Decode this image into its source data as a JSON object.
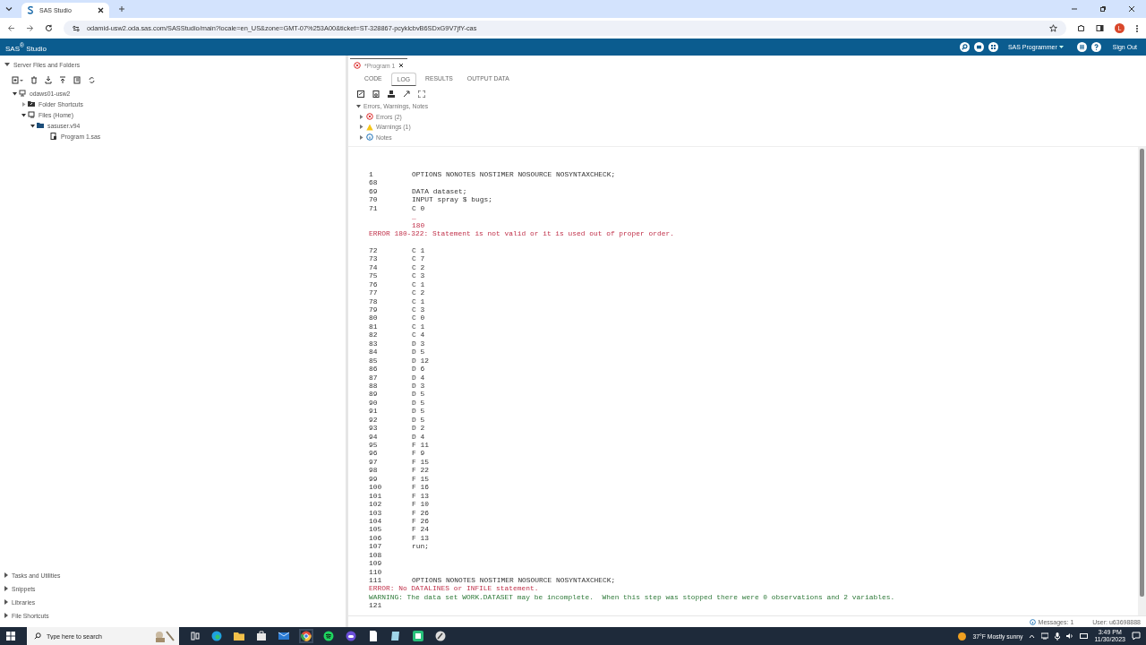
{
  "browser": {
    "tab_title": "SAS Studio",
    "url": "odamid-usw2.oda.sas.com/SASStudio/main?locale=en_US&zone=GMT-07%253A00&ticket=ST-328867-pcyklcbvB6SDxG9V7jfY-cas",
    "profile_initial": "L"
  },
  "app_header": {
    "title": "SAS$^{®}$ Studio",
    "role_menu": "SAS Programmer",
    "sign_out": "Sign Out"
  },
  "sidebar": {
    "section": "Server Files and Folders",
    "expanded": true,
    "tree": [
      {
        "label": "odaws01-usw2",
        "kind": "server",
        "expanded": true,
        "children": [
          {
            "label": "Folder Shortcuts",
            "kind": "shortcuts",
            "expanded": false
          },
          {
            "label": "Files (Home)",
            "kind": "home",
            "expanded": true,
            "children": [
              {
                "label": "sasuser.v94",
                "kind": "folder",
                "expanded": true,
                "children": [
                  {
                    "label": "Program 1.sas",
                    "kind": "program"
                  }
                ]
              }
            ]
          }
        ]
      }
    ],
    "sections": [
      {
        "label": "Tasks and Utilities"
      },
      {
        "label": "Snippets"
      },
      {
        "label": "Libraries"
      },
      {
        "label": "File Shortcuts"
      }
    ]
  },
  "editor": {
    "tab": {
      "title": "*Program 1"
    },
    "subtabs": [
      {
        "label": "CODE",
        "selected": false
      },
      {
        "label": "LOG",
        "selected": true
      },
      {
        "label": "RESULTS",
        "selected": false
      },
      {
        "label": "OUTPUT DATA",
        "selected": false
      }
    ],
    "messages": {
      "title": "Errors, Warnings, Notes",
      "expanded": true,
      "groups": [
        {
          "label": "Errors (2)",
          "kind": "error",
          "expanded": false
        },
        {
          "label": "Warnings (1)",
          "kind": "warning",
          "expanded": false
        },
        {
          "label": "Notes",
          "kind": "note",
          "expanded": false
        }
      ]
    },
    "log": [
      {
        "kind": "code",
        "num": "1",
        "text": "OPTIONS NONOTES NOSTIMER NOSOURCE NOSYNTAXCHECK;"
      },
      {
        "kind": "code",
        "num": "68"
      },
      {
        "kind": "code",
        "num": "69",
        "text": "DATA dataset;"
      },
      {
        "kind": "code",
        "num": "70",
        "text": "INPUT spray $ bugs;"
      },
      {
        "kind": "code",
        "num": "71",
        "text": "C 0"
      },
      {
        "kind": "marker",
        "text": "_"
      },
      {
        "kind": "marker",
        "text": "180"
      },
      {
        "kind": "error",
        "text": "ERROR 180-322: Statement is not valid or it is used out of proper order."
      },
      {
        "kind": "blank"
      },
      {
        "kind": "code",
        "num": "72",
        "text": "C 1"
      },
      {
        "kind": "code",
        "num": "73",
        "text": "C 7"
      },
      {
        "kind": "code",
        "num": "74",
        "text": "C 2"
      },
      {
        "kind": "code",
        "num": "75",
        "text": "C 3"
      },
      {
        "kind": "code",
        "num": "76",
        "text": "C 1"
      },
      {
        "kind": "code",
        "num": "77",
        "text": "C 2"
      },
      {
        "kind": "code",
        "num": "78",
        "text": "C 1"
      },
      {
        "kind": "code",
        "num": "79",
        "text": "C 3"
      },
      {
        "kind": "code",
        "num": "80",
        "text": "C 0"
      },
      {
        "kind": "code",
        "num": "81",
        "text": "C 1"
      },
      {
        "kind": "code",
        "num": "82",
        "text": "C 4"
      },
      {
        "kind": "code",
        "num": "83",
        "text": "D 3"
      },
      {
        "kind": "code",
        "num": "84",
        "text": "D 5"
      },
      {
        "kind": "code",
        "num": "85",
        "text": "D 12"
      },
      {
        "kind": "code",
        "num": "86",
        "text": "D 6"
      },
      {
        "kind": "code",
        "num": "87",
        "text": "D 4"
      },
      {
        "kind": "code",
        "num": "88",
        "text": "D 3"
      },
      {
        "kind": "code",
        "num": "89",
        "text": "D 5"
      },
      {
        "kind": "code",
        "num": "90",
        "text": "D 5"
      },
      {
        "kind": "code",
        "num": "91",
        "text": "D 5"
      },
      {
        "kind": "code",
        "num": "92",
        "text": "D 5"
      },
      {
        "kind": "code",
        "num": "93",
        "text": "D 2"
      },
      {
        "kind": "code",
        "num": "94",
        "text": "D 4"
      },
      {
        "kind": "code",
        "num": "95",
        "text": "F 11"
      },
      {
        "kind": "code",
        "num": "96",
        "text": "F 9"
      },
      {
        "kind": "code",
        "num": "97",
        "text": "F 15"
      },
      {
        "kind": "code",
        "num": "98",
        "text": "F 22"
      },
      {
        "kind": "code",
        "num": "99",
        "text": "F 15"
      },
      {
        "kind": "code",
        "num": "100",
        "text": "F 16"
      },
      {
        "kind": "code",
        "num": "101",
        "text": "F 13"
      },
      {
        "kind": "code",
        "num": "102",
        "text": "F 10"
      },
      {
        "kind": "code",
        "num": "103",
        "text": "F 26"
      },
      {
        "kind": "code",
        "num": "104",
        "text": "F 26"
      },
      {
        "kind": "code",
        "num": "105",
        "text": "F 24"
      },
      {
        "kind": "code",
        "num": "106",
        "text": "F 13"
      },
      {
        "kind": "code",
        "num": "107",
        "text": "run;"
      },
      {
        "kind": "code",
        "num": "108"
      },
      {
        "kind": "code",
        "num": "109"
      },
      {
        "kind": "code",
        "num": "110"
      },
      {
        "kind": "code",
        "num": "111",
        "text": "OPTIONS NONOTES NOSTIMER NOSOURCE NOSYNTAXCHECK;"
      },
      {
        "kind": "error",
        "text": "ERROR: No DATALINES or INFILE statement."
      },
      {
        "kind": "warning",
        "text": "WARNING: The data set WORK.DATASET may be incomplete.  When this step was stopped there were 0 observations and 2 variables."
      },
      {
        "kind": "code",
        "num": "121"
      }
    ]
  },
  "status_bar": {
    "messages": "Messages: 1",
    "user": "User: u63698888"
  },
  "taskbar": {
    "search_placeholder": "Type here to search",
    "weather": "37°F Mostly sunny",
    "time": "3:49 PM",
    "date": "11/30/2023"
  }
}
